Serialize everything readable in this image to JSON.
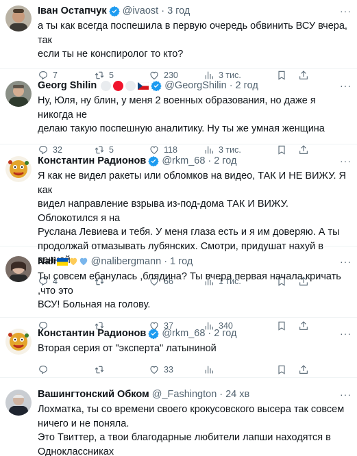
{
  "tweets": [
    {
      "name": "Іван Остапчук",
      "handle": "@ivaost",
      "time": "3 год",
      "text": "а ты как всегда поспешила в первую очередь обвинить ВСУ вчера, так\nесли ты не конспиролог то кто?",
      "replies": "7",
      "retweets": "5",
      "likes": "230",
      "views": "3 тис."
    },
    {
      "name": "Georg Shilin",
      "handle": "@GeorgShilin",
      "time": "2 год",
      "text": "Ну, Юля, ну блин, у меня 2 военных образования, но даже я никогда не\nделаю такую поспешную аналитику. Ну ты же умная женщина",
      "replies": "32",
      "retweets": "5",
      "likes": "118",
      "views": "3 тис."
    },
    {
      "name": "Константин Радионов",
      "handle": "@rkm_68",
      "time": "2 год",
      "text": "Я как не видел ракеты или обломков на видео, ТАК И НЕ ВИЖУ. Я как\nвидел направление взрыва из-под-дома ТАК И ВИЖУ. Облокотился я на\nРуслана Левиева и тебя. У меня глаза есть и я им доверяю. А ты\nпродолжай отмазывать лубянских. Смотри, придушат нахуй в ванной.",
      "replies": "4",
      "retweets": "",
      "likes": "66",
      "views": "1 тис."
    },
    {
      "name": "Nali",
      "handle": "@nalibergmann",
      "time": "1 год",
      "text": "Ты совсем ебанулась ,блядина? Ты вчера первая начала кричать ,что это\nВСУ! Больная на голову.",
      "replies": "",
      "retweets": "",
      "likes": "37",
      "views": "340"
    },
    {
      "name": "Константин Радионов",
      "handle": "@rkm_68",
      "time": "2 год",
      "text": "Вторая серия от \"эксперта\" латыниной",
      "replies": "",
      "retweets": "",
      "likes": "33",
      "views": ""
    },
    {
      "name": "Вашингтонский Обком",
      "handle": "@_Fashington",
      "time": "24 хв",
      "text": "Лохматка, ты со времени своего крокусовского высера так совсем\nничего и не поняла.\nЭто Твиттер, а твои благодарные любители лапши находятся в\nОдноклассниках"
    }
  ],
  "ui": {
    "dot": "·",
    "more": "···"
  },
  "colors": {
    "verified": "#1d9bf0",
    "text": "#0f1419",
    "muted": "#536471"
  }
}
